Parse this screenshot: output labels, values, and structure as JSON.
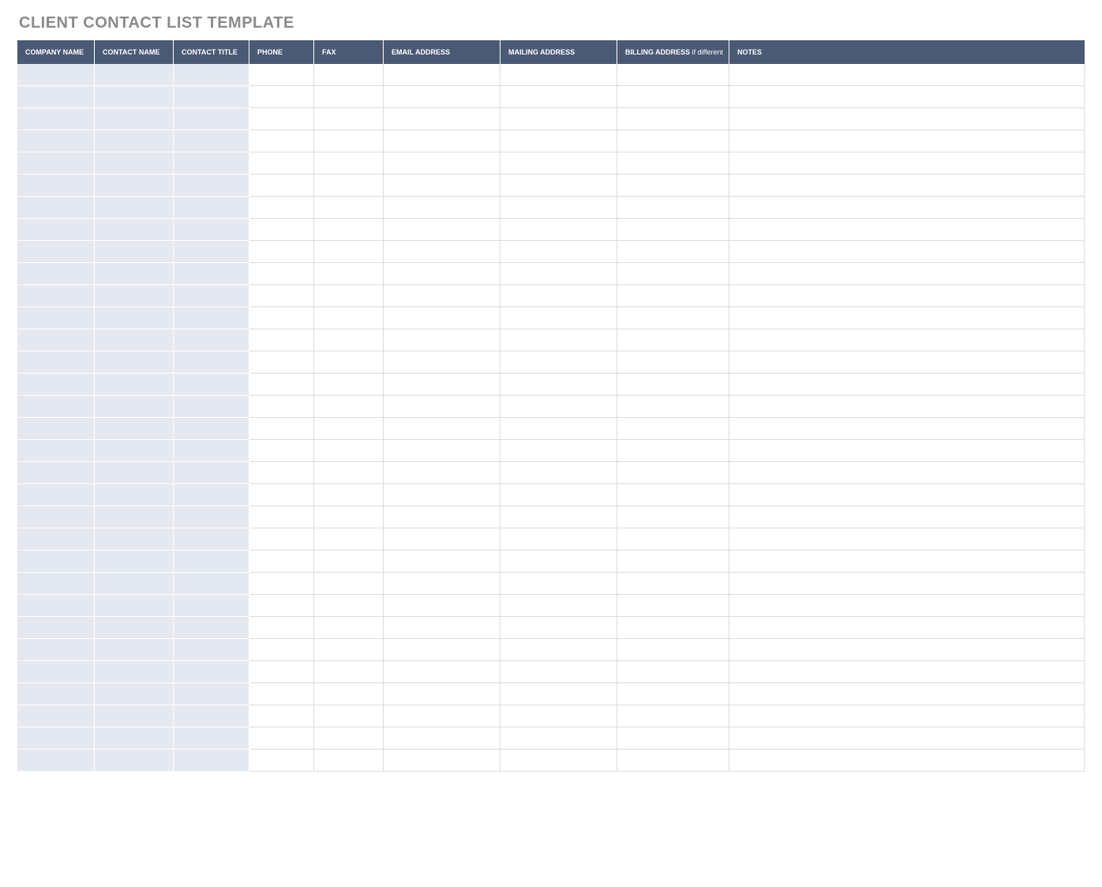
{
  "title": "CLIENT CONTACT LIST TEMPLATE",
  "columns": {
    "company": "COMPANY NAME",
    "contact": "CONTACT NAME",
    "ctitle": "CONTACT TITLE",
    "phone": "PHONE",
    "fax": "FAX",
    "email": "EMAIL ADDRESS",
    "mailing": "MAILING ADDRESS",
    "billing_bold": "BILLING ADDRESS",
    "billing_sub": " if different",
    "notes": "NOTES"
  },
  "row_count": 32,
  "rows": [
    {
      "company": "",
      "contact": "",
      "ctitle": "",
      "phone": "",
      "fax": "",
      "email": "",
      "mailing": "",
      "billing": "",
      "notes": ""
    },
    {
      "company": "",
      "contact": "",
      "ctitle": "",
      "phone": "",
      "fax": "",
      "email": "",
      "mailing": "",
      "billing": "",
      "notes": ""
    },
    {
      "company": "",
      "contact": "",
      "ctitle": "",
      "phone": "",
      "fax": "",
      "email": "",
      "mailing": "",
      "billing": "",
      "notes": ""
    },
    {
      "company": "",
      "contact": "",
      "ctitle": "",
      "phone": "",
      "fax": "",
      "email": "",
      "mailing": "",
      "billing": "",
      "notes": ""
    },
    {
      "company": "",
      "contact": "",
      "ctitle": "",
      "phone": "",
      "fax": "",
      "email": "",
      "mailing": "",
      "billing": "",
      "notes": ""
    },
    {
      "company": "",
      "contact": "",
      "ctitle": "",
      "phone": "",
      "fax": "",
      "email": "",
      "mailing": "",
      "billing": "",
      "notes": ""
    },
    {
      "company": "",
      "contact": "",
      "ctitle": "",
      "phone": "",
      "fax": "",
      "email": "",
      "mailing": "",
      "billing": "",
      "notes": ""
    },
    {
      "company": "",
      "contact": "",
      "ctitle": "",
      "phone": "",
      "fax": "",
      "email": "",
      "mailing": "",
      "billing": "",
      "notes": ""
    },
    {
      "company": "",
      "contact": "",
      "ctitle": "",
      "phone": "",
      "fax": "",
      "email": "",
      "mailing": "",
      "billing": "",
      "notes": ""
    },
    {
      "company": "",
      "contact": "",
      "ctitle": "",
      "phone": "",
      "fax": "",
      "email": "",
      "mailing": "",
      "billing": "",
      "notes": ""
    },
    {
      "company": "",
      "contact": "",
      "ctitle": "",
      "phone": "",
      "fax": "",
      "email": "",
      "mailing": "",
      "billing": "",
      "notes": ""
    },
    {
      "company": "",
      "contact": "",
      "ctitle": "",
      "phone": "",
      "fax": "",
      "email": "",
      "mailing": "",
      "billing": "",
      "notes": ""
    },
    {
      "company": "",
      "contact": "",
      "ctitle": "",
      "phone": "",
      "fax": "",
      "email": "",
      "mailing": "",
      "billing": "",
      "notes": ""
    },
    {
      "company": "",
      "contact": "",
      "ctitle": "",
      "phone": "",
      "fax": "",
      "email": "",
      "mailing": "",
      "billing": "",
      "notes": ""
    },
    {
      "company": "",
      "contact": "",
      "ctitle": "",
      "phone": "",
      "fax": "",
      "email": "",
      "mailing": "",
      "billing": "",
      "notes": ""
    },
    {
      "company": "",
      "contact": "",
      "ctitle": "",
      "phone": "",
      "fax": "",
      "email": "",
      "mailing": "",
      "billing": "",
      "notes": ""
    },
    {
      "company": "",
      "contact": "",
      "ctitle": "",
      "phone": "",
      "fax": "",
      "email": "",
      "mailing": "",
      "billing": "",
      "notes": ""
    },
    {
      "company": "",
      "contact": "",
      "ctitle": "",
      "phone": "",
      "fax": "",
      "email": "",
      "mailing": "",
      "billing": "",
      "notes": ""
    },
    {
      "company": "",
      "contact": "",
      "ctitle": "",
      "phone": "",
      "fax": "",
      "email": "",
      "mailing": "",
      "billing": "",
      "notes": ""
    },
    {
      "company": "",
      "contact": "",
      "ctitle": "",
      "phone": "",
      "fax": "",
      "email": "",
      "mailing": "",
      "billing": "",
      "notes": ""
    },
    {
      "company": "",
      "contact": "",
      "ctitle": "",
      "phone": "",
      "fax": "",
      "email": "",
      "mailing": "",
      "billing": "",
      "notes": ""
    },
    {
      "company": "",
      "contact": "",
      "ctitle": "",
      "phone": "",
      "fax": "",
      "email": "",
      "mailing": "",
      "billing": "",
      "notes": ""
    },
    {
      "company": "",
      "contact": "",
      "ctitle": "",
      "phone": "",
      "fax": "",
      "email": "",
      "mailing": "",
      "billing": "",
      "notes": ""
    },
    {
      "company": "",
      "contact": "",
      "ctitle": "",
      "phone": "",
      "fax": "",
      "email": "",
      "mailing": "",
      "billing": "",
      "notes": ""
    },
    {
      "company": "",
      "contact": "",
      "ctitle": "",
      "phone": "",
      "fax": "",
      "email": "",
      "mailing": "",
      "billing": "",
      "notes": ""
    },
    {
      "company": "",
      "contact": "",
      "ctitle": "",
      "phone": "",
      "fax": "",
      "email": "",
      "mailing": "",
      "billing": "",
      "notes": ""
    },
    {
      "company": "",
      "contact": "",
      "ctitle": "",
      "phone": "",
      "fax": "",
      "email": "",
      "mailing": "",
      "billing": "",
      "notes": ""
    },
    {
      "company": "",
      "contact": "",
      "ctitle": "",
      "phone": "",
      "fax": "",
      "email": "",
      "mailing": "",
      "billing": "",
      "notes": ""
    },
    {
      "company": "",
      "contact": "",
      "ctitle": "",
      "phone": "",
      "fax": "",
      "email": "",
      "mailing": "",
      "billing": "",
      "notes": ""
    },
    {
      "company": "",
      "contact": "",
      "ctitle": "",
      "phone": "",
      "fax": "",
      "email": "",
      "mailing": "",
      "billing": "",
      "notes": ""
    },
    {
      "company": "",
      "contact": "",
      "ctitle": "",
      "phone": "",
      "fax": "",
      "email": "",
      "mailing": "",
      "billing": "",
      "notes": ""
    },
    {
      "company": "",
      "contact": "",
      "ctitle": "",
      "phone": "",
      "fax": "",
      "email": "",
      "mailing": "",
      "billing": "",
      "notes": ""
    }
  ]
}
